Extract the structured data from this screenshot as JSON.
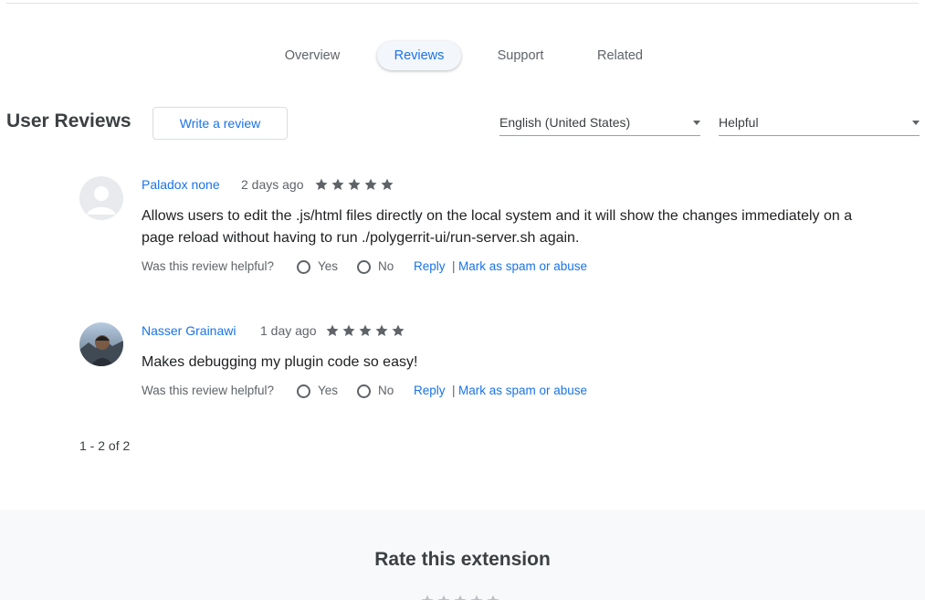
{
  "tabs": [
    "Overview",
    "Reviews",
    "Support",
    "Related"
  ],
  "active_tab": "Reviews",
  "section": {
    "title": "User Reviews",
    "write_review_label": "Write a review"
  },
  "filters": {
    "language": "English (United States)",
    "sort": "Helpful"
  },
  "reviews": [
    {
      "author": "Paladox none",
      "date": "2 days ago",
      "rating": 5,
      "text": "Allows users to edit the .js/html files directly on the local system and it will show the changes immediately on a page reload without having to run ./polygerrit-ui/run-server.sh again.",
      "helpful_prompt": "Was this review helpful?",
      "yes_label": "Yes",
      "no_label": "No",
      "reply_label": "Reply",
      "separator": "|",
      "spam_label": "Mark as spam or abuse"
    },
    {
      "author": "Nasser Grainawi",
      "date": "1 day ago",
      "rating": 5,
      "text": "Makes debugging my plugin code so easy!",
      "helpful_prompt": "Was this review helpful?",
      "yes_label": "Yes",
      "no_label": "No",
      "reply_label": "Reply",
      "separator": "|",
      "spam_label": "Mark as spam or abuse"
    }
  ],
  "pagination": "1 - 2 of 2",
  "rate": {
    "title": "Rate this extension",
    "rating": 0
  },
  "icons": {
    "star": "star-icon",
    "avatar": "avatar-icon",
    "caret": "chevron-down-icon",
    "radio": "radio-button-icon"
  },
  "colors": {
    "link": "#1a73e8",
    "star": "#5f6368",
    "star_empty": "#bdc1c6",
    "rate_bg": "#f8f9fa"
  }
}
